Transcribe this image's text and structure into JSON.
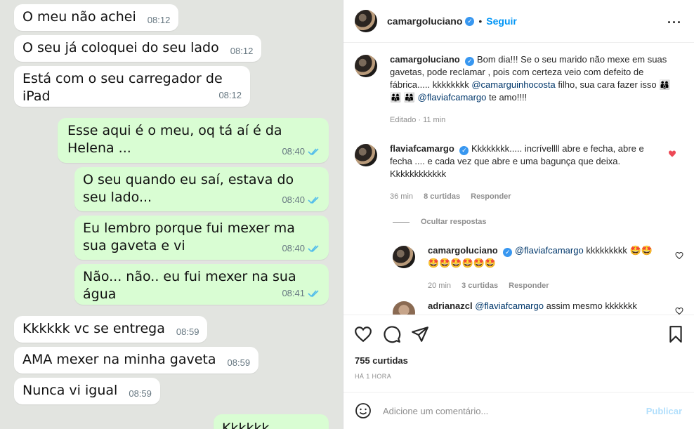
{
  "chat": {
    "messages": [
      {
        "dir": "in",
        "text": "O meu não achei",
        "time": "08:12"
      },
      {
        "dir": "in",
        "text": "O seu já coloquei do seu lado",
        "time": "08:12"
      },
      {
        "dir": "in",
        "text": "Está com o seu carregador de iPad",
        "time": "08:12"
      },
      {
        "dir": "out",
        "text": "Esse aqui é o meu, oq tá aí é da Helena ...",
        "time": "08:40"
      },
      {
        "dir": "out",
        "text": "O seu quando eu saí, estava do seu lado...",
        "time": "08:40"
      },
      {
        "dir": "out",
        "text": "Eu lembro porque fui mexer ma sua gaveta e vi",
        "time": "08:40"
      },
      {
        "dir": "out",
        "text": "Não... não.. eu fui mexer na sua água",
        "time": "08:41"
      },
      {
        "dir": "in",
        "text": "Kkkkkk vc se entrega",
        "time": "08:59"
      },
      {
        "dir": "in",
        "text": "AMA mexer na minha gaveta",
        "time": "08:59"
      },
      {
        "dir": "in",
        "text": "Nunca vi igual",
        "time": "08:59"
      },
      {
        "dir": "out",
        "text": "Kkkkkk",
        "time": ""
      }
    ],
    "colors": {
      "incoming": "#ffffff",
      "outgoing": "#d9fdd3",
      "ticks": "#53bdeb",
      "background": "#e2e4e0"
    }
  },
  "post": {
    "header": {
      "username": "camargoluciano",
      "follow_label": "Seguir",
      "more_icon": "more-icon"
    },
    "caption": {
      "username": "camargoluciano",
      "text_1": "Bom dia!!! Se o seu marido não mexe em suas gavetas, pode reclamar , pois com certeza veio com defeito de fábrica..... kkkkkkkk",
      "mention_1": "@camarguinhocosta",
      "text_2": "filho, sua cara fazer isso",
      "emojis": "👨‍👩‍👦 👨‍👩‍👦 👨‍👩‍👦",
      "mention_2": "@flaviafcamargo",
      "text_3": "te amo!!!!",
      "meta": "Editado · 11 min"
    },
    "comments": [
      {
        "username": "flaviafcamargo",
        "text": "Kkkkkkkk..... incrívellll abre e fecha, abre e fecha .... e cada vez que abre e uma bagunça que deixa. Kkkkkkkkkkkk",
        "time": "36 min",
        "likes": "8 curtidas",
        "reply": "Responder",
        "liked": true
      }
    ],
    "hide_replies": "Ocultar respostas",
    "replies": [
      {
        "username": "camargoluciano",
        "mention": "@flaviafcamargo",
        "text": "kkkkkkkkk 🤩🤩",
        "emojis_line2": "🤩🤩🤩🤩🤩🤩",
        "time": "20 min",
        "likes": "3 curtidas",
        "reply": "Responder"
      },
      {
        "username": "adrianazcl",
        "mention": "@flaviafcamargo",
        "text": "assim mesmo kkkkkkk"
      }
    ],
    "likes": "755 curtidas",
    "posted": "HÁ 1 HORA",
    "comment_placeholder": "Adicione um comentário...",
    "publish_label": "Publicar",
    "colors": {
      "link": "#00376b",
      "follow": "#0095f6",
      "heart": "#ed4956"
    }
  }
}
